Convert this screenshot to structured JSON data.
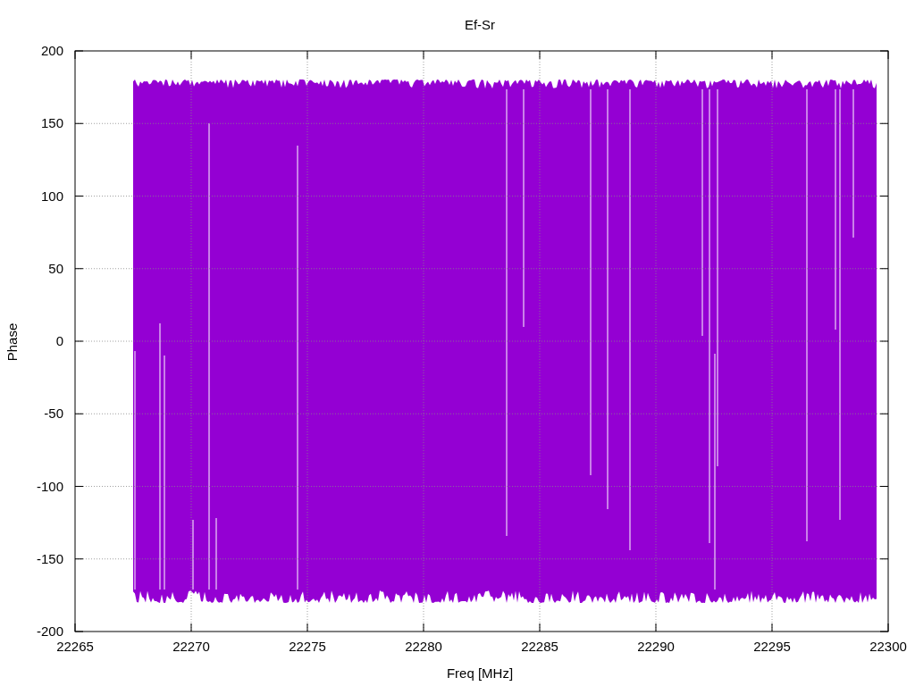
{
  "plot": {
    "title": "Ef-Sr",
    "xlabel": "Freq [MHz]",
    "ylabel": "Phase",
    "xticks": [
      "22265",
      "22270",
      "22275",
      "22280",
      "22285",
      "22290",
      "22295",
      "22300"
    ],
    "yticks": [
      "200",
      "150",
      "100",
      "50",
      "0",
      "-50",
      "-100",
      "-150",
      "-200"
    ]
  }
}
